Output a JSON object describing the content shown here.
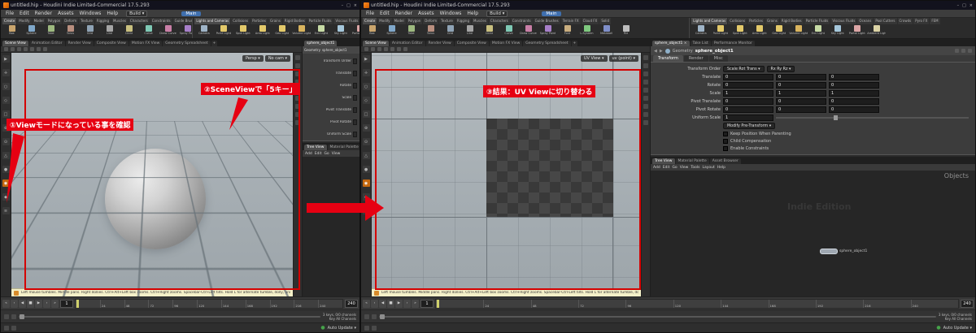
{
  "annotations": {
    "step1": "①Viewモードになっている事を確認",
    "step2": "②SceneViewで「5キー」",
    "step3": "③結果：UV Viewに切り替わる"
  },
  "app": {
    "title": "untitled.hip - Houdini Indie Limited-Commercial 17.5.293",
    "menus": [
      "File",
      "Edit",
      "Render",
      "Assets",
      "Windows",
      "Help"
    ],
    "desktop_label": "Build",
    "take_label": "Main",
    "node_type": "Geometry",
    "node_name": "sphere_object1",
    "icons": {
      "dropdown": "▾",
      "close": "×",
      "minimize": "–",
      "maximize": "□",
      "plus": "+",
      "status_dot": "●"
    },
    "shelf_tabs_left": [
      "Create",
      "Modify",
      "Model",
      "Polygon",
      "Deform",
      "Texture",
      "Rigging",
      "Muscles",
      "Characters",
      "Constraints",
      "Guide Brushes",
      "Terrain FX",
      "Cloud FX",
      "Solid"
    ],
    "shelf_tabs_right": [
      "Lights and Cameras",
      "Collisions",
      "Particles",
      "Grains",
      "Rigid Bodies",
      "Particle Fluids",
      "Viscous Fluids",
      "Oceans",
      "Pool Cutters",
      "Crowds",
      "Pyro FX",
      "FEM"
    ],
    "shelf_tools_left": [
      {
        "label": "Box",
        "color": "#caa56d"
      },
      {
        "label": "Sphere",
        "color": "#7fa7c9"
      },
      {
        "label": "Tube",
        "color": "#9db97f"
      },
      {
        "label": "Torus",
        "color": "#b98f7f"
      },
      {
        "label": "Grid",
        "color": "#8fa3b5"
      },
      {
        "label": "Line",
        "color": "#a5a5a5"
      },
      {
        "label": "Circle",
        "color": "#c9c07f"
      },
      {
        "label": "Curve",
        "color": "#7fc9b5"
      },
      {
        "label": "Draw Curve",
        "color": "#c97fa7"
      },
      {
        "label": "Spray Paint",
        "color": "#a77fc9"
      },
      {
        "label": "Font",
        "color": "#c9ae7f"
      },
      {
        "label": "L-System",
        "color": "#7fc97f"
      },
      {
        "label": "Metaball",
        "color": "#7f8fc9"
      },
      {
        "label": "File",
        "color": "#bdbdbd"
      }
    ],
    "shelf_tools_right": [
      {
        "label": "Camera",
        "color": "#9fb4c7"
      },
      {
        "label": "Point Light",
        "color": "#e3c96a"
      },
      {
        "label": "Spot Light",
        "color": "#e3c96a"
      },
      {
        "label": "Area Light",
        "color": "#e3c96a"
      },
      {
        "label": "Geo Light",
        "color": "#e3c96a"
      },
      {
        "label": "Volume Light",
        "color": "#d9b45e"
      },
      {
        "label": "Env Light",
        "color": "#c7dba5"
      },
      {
        "label": "Sky Light",
        "color": "#a5c7db"
      },
      {
        "label": "Portal Light",
        "color": "#dba5a5"
      },
      {
        "label": "Ambient Light",
        "color": "#dbd3a5"
      }
    ],
    "pane_tabs": [
      "Scene View",
      "Animation Editor",
      "Render View",
      "Composite View",
      "Motion FX View",
      "Geometry Spreadsheet"
    ],
    "side_tools": [
      {
        "name": "select-tool-icon",
        "glyph": "▶"
      },
      {
        "name": "translate-tool-icon",
        "glyph": "✛"
      },
      {
        "name": "rotate-tool-icon",
        "glyph": "○"
      },
      {
        "name": "scale-tool-icon",
        "glyph": "◇"
      },
      {
        "name": "pose-tool-icon",
        "glyph": "□"
      },
      {
        "name": "snap-toggle-icon",
        "glyph": "⊕"
      },
      {
        "name": "construction-plane-icon",
        "glyph": "⊙"
      },
      {
        "name": "points-display-icon",
        "glyph": "△"
      },
      {
        "name": "quickmark-icon",
        "glyph": "●"
      },
      {
        "name": "view-mode-icon",
        "glyph": "◉"
      },
      {
        "name": "lasso-select-icon",
        "glyph": "◆"
      },
      {
        "name": "menu-icon",
        "glyph": "≡"
      }
    ],
    "side_tool_highlight": 9,
    "transport_icons": [
      {
        "name": "jump-to-start-icon",
        "glyph": "«"
      },
      {
        "name": "previous-frame-icon",
        "glyph": "‹"
      },
      {
        "name": "play-reverse-icon",
        "glyph": "◀"
      },
      {
        "name": "stop-icon",
        "glyph": "■"
      },
      {
        "name": "play-forward-icon",
        "glyph": "▶"
      },
      {
        "name": "next-frame-icon",
        "glyph": "›"
      },
      {
        "name": "jump-to-end-icon",
        "glyph": "»"
      }
    ],
    "help_text": "Left mouse tumbles. Middle pans. Right dollies. Ctrl+Alt+Left box zooms. Ctrl+Right zooms. Spacebar-Ctrl-Left tilts. Hold L for alternate tumble, dolly, and zoom.",
    "playbar": {
      "frame_current": "1",
      "frame_end": "240",
      "ticks": [
        "1",
        "24",
        "48",
        "72",
        "96",
        "120",
        "144",
        "168",
        "192",
        "216",
        "240"
      ],
      "keys_info": "3 keys, 0/0 channels",
      "key_all_label": "Key All Channels",
      "auto_update_label": "Auto Update"
    }
  },
  "left_window": {
    "viewport": {
      "view_label": "Persp",
      "cam_label": "No cam"
    },
    "param_labels": [
      "Transform Order",
      "Translate",
      "Rotate",
      "Scale",
      "Pivot Translate",
      "Pivot Rotate",
      "Uniform Scale"
    ],
    "lower_tabs": [
      "Tree View",
      "Material Palette"
    ],
    "net_menu": [
      "Add",
      "Edit",
      "Go",
      "View"
    ]
  },
  "right_window": {
    "viewport": {
      "view_label": "UV View",
      "attr_label": "uv (point)"
    },
    "params": {
      "pane_tabs": [
        "sphere_object1",
        "Take List",
        "Performance Monitor"
      ],
      "tabs": [
        "Transform",
        "Render",
        "Misc"
      ],
      "transform_order_label": "Transform Order",
      "transform_order_values": [
        "Scale Rot Trans",
        "Rx Ry Rz"
      ],
      "rows": [
        {
          "label": "Translate",
          "values": [
            "0",
            "0",
            "0"
          ]
        },
        {
          "label": "Rotate",
          "values": [
            "0",
            "0",
            "0"
          ]
        },
        {
          "label": "Scale",
          "values": [
            "1",
            "1",
            "1"
          ]
        },
        {
          "label": "Pivot Translate",
          "values": [
            "0",
            "0",
            "0"
          ]
        },
        {
          "label": "Pivot Rotate",
          "values": [
            "0",
            "0",
            "0"
          ]
        },
        {
          "label": "Uniform Scale",
          "values": [
            "1"
          ]
        }
      ],
      "pretransform_label": "Modify Pre-Transform",
      "checkboxes": [
        "Keep Position When Parenting",
        "Child Compensation",
        "Enable Constraints"
      ]
    },
    "network": {
      "tabs": [
        "Tree View",
        "Material Palette",
        "Asset Browser"
      ],
      "menu": [
        "Add",
        "Edit",
        "Go",
        "View",
        "Tools",
        "Layout",
        "Help"
      ],
      "context_label": "Objects",
      "watermark": "Indie Edition"
    }
  }
}
